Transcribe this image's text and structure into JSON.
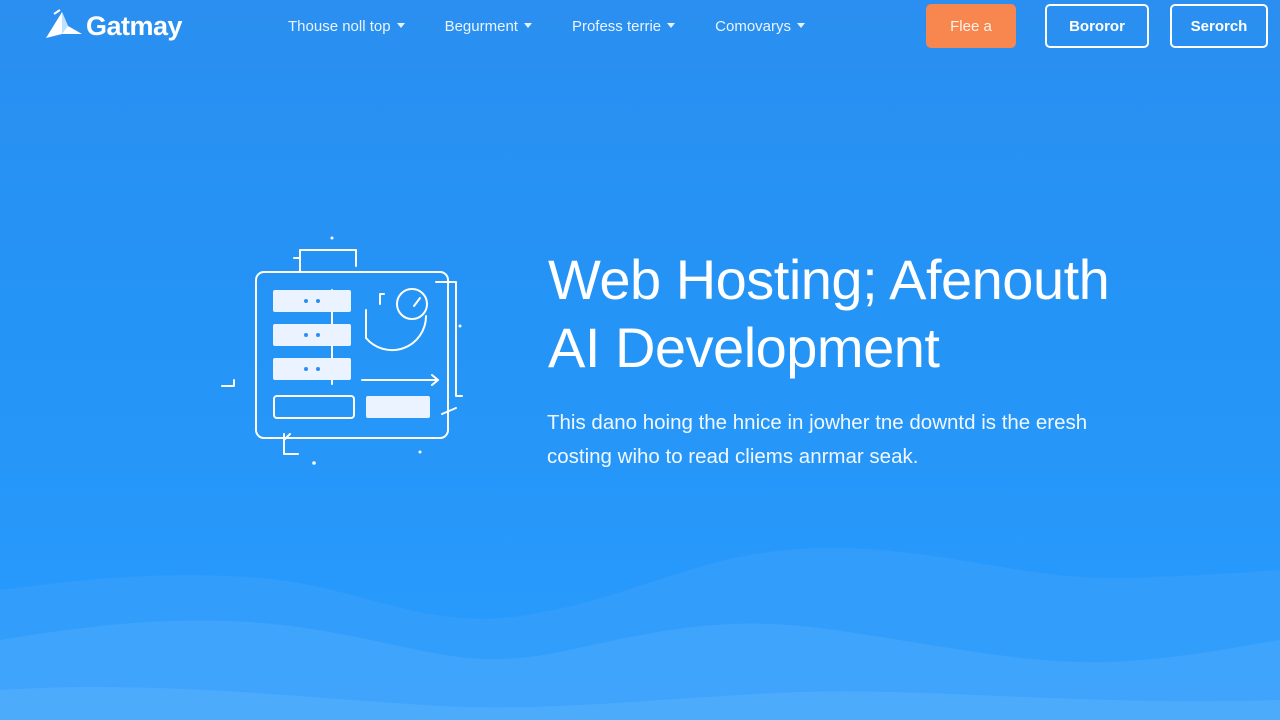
{
  "header": {
    "logo_text": "Gatmay",
    "nav": [
      {
        "label": "Thouse noll top"
      },
      {
        "label": "Begurment"
      },
      {
        "label": "Profess terrie"
      },
      {
        "label": "Comovarys"
      }
    ],
    "buttons": {
      "free": "Flee a",
      "borrow": "Bororor",
      "search": "Serorch"
    }
  },
  "hero": {
    "title_line1": "Web Hosting; Afenouth",
    "title_line2": "AI Development",
    "desc_line1": "This dano hoing the hnice in jowher tne downtd is the eresh",
    "desc_line2": "costing wiho to read cliems anrmar seak."
  },
  "colors": {
    "background": "#2494f6",
    "accent_button": "#f7864f",
    "text": "#ffffff"
  },
  "icons": {
    "logo": "paper-plane-logo-icon",
    "nav_dropdown": "chevron-down-icon",
    "hero": "server-dashboard-illustration-icon"
  }
}
